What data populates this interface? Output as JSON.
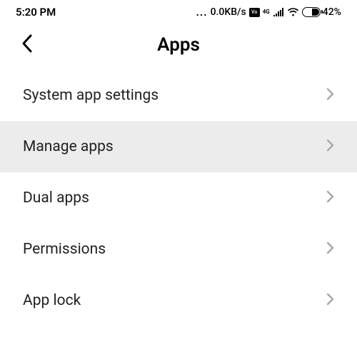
{
  "status": {
    "time": "5:20 PM",
    "dots": "...",
    "speed": "0.0KB/s",
    "vo_icon": "Vo",
    "net_label": "4G",
    "battery_pct": "42%"
  },
  "header": {
    "title": "Apps"
  },
  "list": {
    "items": [
      {
        "label": "System app settings",
        "selected": false
      },
      {
        "label": "Manage apps",
        "selected": true
      },
      {
        "label": "Dual apps",
        "selected": false
      },
      {
        "label": "Permissions",
        "selected": false
      },
      {
        "label": "App lock",
        "selected": false
      }
    ]
  }
}
